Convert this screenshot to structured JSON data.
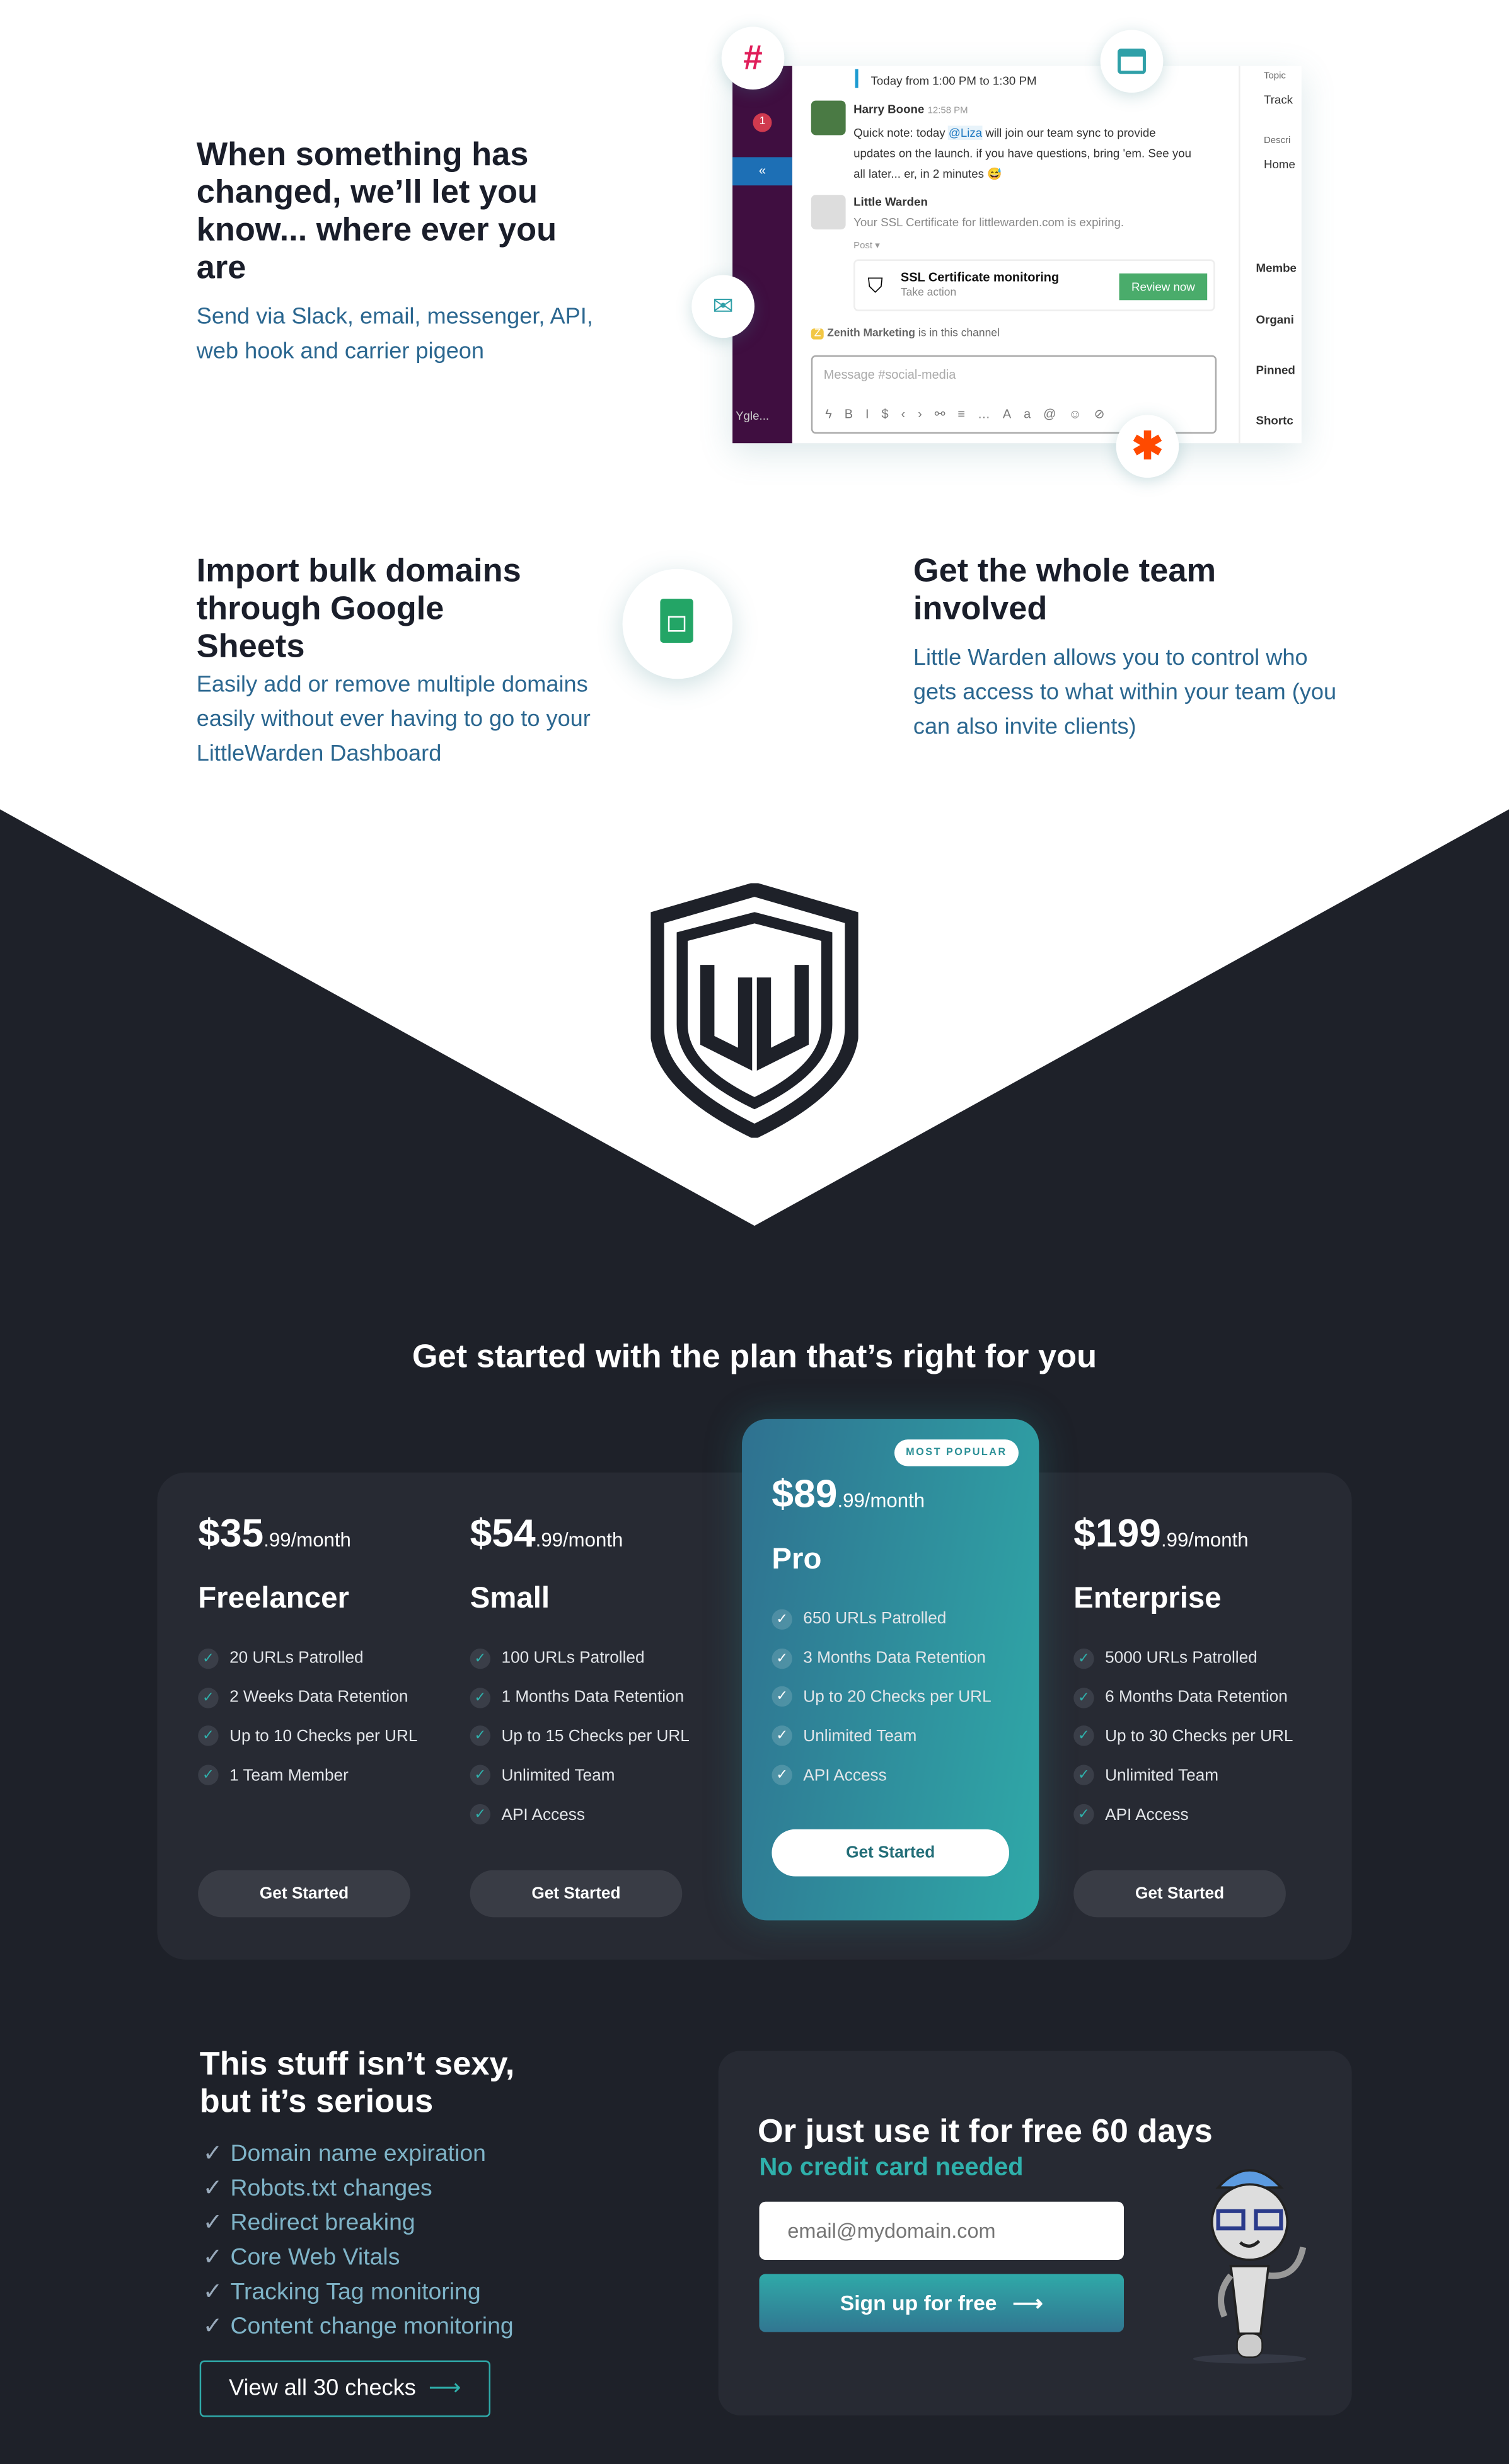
{
  "features": {
    "notify": {
      "title": "When something has changed, we’ll let you know... where ever you are",
      "subtitle": "Send via Slack, email, messenger, API, web hook and carrier pigeon"
    },
    "sheets": {
      "title": "Import bulk domains through Google Sheets",
      "subtitle": "Easily add or remove multiple domains easily without ever having to go to your LittleWarden Dashboard"
    },
    "team": {
      "title": "Get the whole team involved",
      "subtitle": "Little Warden allows you to control who gets access to what within your team (you can also invite clients)"
    }
  },
  "slack": {
    "badge": "1",
    "workspace": "Ygle...",
    "event": "Today from 1:00 PM to 1:30 PM",
    "msg1": {
      "author": "Harry Boone",
      "time": "12:58 PM",
      "pre": "Quick note: today ",
      "mention": "@Liza",
      "post": " will join our team sync to provide updates on the launch. if you have questions, bring 'em. See you all later... er, in 2 minutes 😅"
    },
    "msg2": {
      "author": "Little Warden",
      "text": "Your SSL Certificate for littlewarden.com is expiring."
    },
    "post_label": "Post ▾",
    "attachment": {
      "title": "SSL Certificate monitoring",
      "subtitle": "Take action",
      "button": "Review now"
    },
    "channel_note_name": "Zenith Marketing",
    "channel_note": " is in this channel",
    "composer_placeholder": "Message #social-media",
    "details": [
      "Topic",
      "Track",
      "Descri",
      "Home",
      "Membe",
      "Organi",
      "Pinned",
      "Shortc"
    ]
  },
  "pricing": {
    "heading": "Get started with the plan that’s right for you",
    "badge": "MOST POPULAR",
    "plans": [
      {
        "price": "$35",
        "cents": ".99/month",
        "name": "Freelancer",
        "features": [
          "20 URLs Patrolled",
          "2 Weeks Data Retention",
          "Up to 10 Checks per URL",
          "1 Team Member"
        ],
        "cta": "Get Started"
      },
      {
        "price": "$54",
        "cents": ".99/month",
        "name": "Small",
        "features": [
          "100 URLs Patrolled",
          "1 Months Data Retention",
          "Up to 15 Checks per URL",
          "Unlimited Team",
          "API Access"
        ],
        "cta": "Get Started"
      },
      {
        "price": "$89",
        "cents": ".99/month",
        "name": "Pro",
        "features": [
          "650 URLs Patrolled",
          "3 Months Data Retention",
          "Up to 20 Checks per URL",
          "Unlimited Team",
          "API Access"
        ],
        "cta": "Get Started"
      },
      {
        "price": "$199",
        "cents": ".99/month",
        "name": "Enterprise",
        "features": [
          "5000 URLs Patrolled",
          "6 Months Data Retention",
          "Up to 30 Checks per URL",
          "Unlimited Team",
          "API Access"
        ],
        "cta": "Get Started"
      }
    ]
  },
  "checks": {
    "title_line1": "This stuff isn’t sexy,",
    "title_line2": "but it’s serious",
    "items": [
      "Domain name expiration",
      "Robots.txt changes",
      "Redirect breaking",
      "Core Web Vitals",
      "Tracking Tag monitoring",
      "Content change monitoring"
    ],
    "button": "View all 30 checks"
  },
  "signup": {
    "title": "Or just use it for free 60 days",
    "subtitle": "No credit card needed",
    "email_placeholder": "email@mydomain.com",
    "button": "Sign up for free"
  },
  "colors": {
    "dark": "#1e2129",
    "card": "#272a33",
    "teal": "#2fb0ab",
    "blue_text": "#2b6790"
  }
}
